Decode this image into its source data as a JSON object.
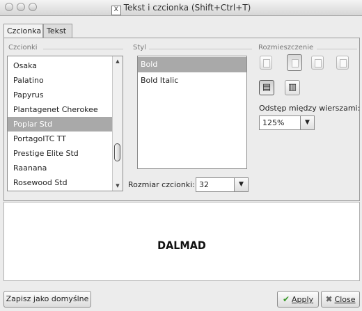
{
  "window": {
    "title": "Tekst i czcionka (Shift+Ctrl+T)"
  },
  "tabs": [
    {
      "label": "Czcionka",
      "active": true
    },
    {
      "label": "Tekst",
      "active": false
    }
  ],
  "fonts_group": {
    "label": "Czcionki",
    "items": [
      "Osaka",
      "Palatino",
      "Papyrus",
      "Plantagenet Cherokee",
      "Poplar Std",
      "PortagoITC TT",
      "Prestige Elite Std",
      "Raanana",
      "Rosewood Std"
    ],
    "selected": "Poplar Std"
  },
  "style_group": {
    "label": "Styl",
    "items": [
      "Bold",
      "Bold Italic"
    ],
    "selected": "Bold"
  },
  "size": {
    "label": "Rozmiar czcionki:",
    "value": "32"
  },
  "placement_group": {
    "label": "Rozmieszczenie"
  },
  "line_spacing": {
    "label": "Odstęp między wierszami:",
    "value": "125%"
  },
  "preview": {
    "text": "DALMAD"
  },
  "buttons": {
    "save_default": "Zapisz jako domyślne",
    "apply": "Apply",
    "close": "Close"
  },
  "icons": [
    "window-icon",
    "align-left-icon",
    "align-center-icon",
    "align-right-icon",
    "align-justify-icon",
    "horizontal-text-icon",
    "vertical-text-icon",
    "apply-check-icon",
    "close-x-icon"
  ]
}
